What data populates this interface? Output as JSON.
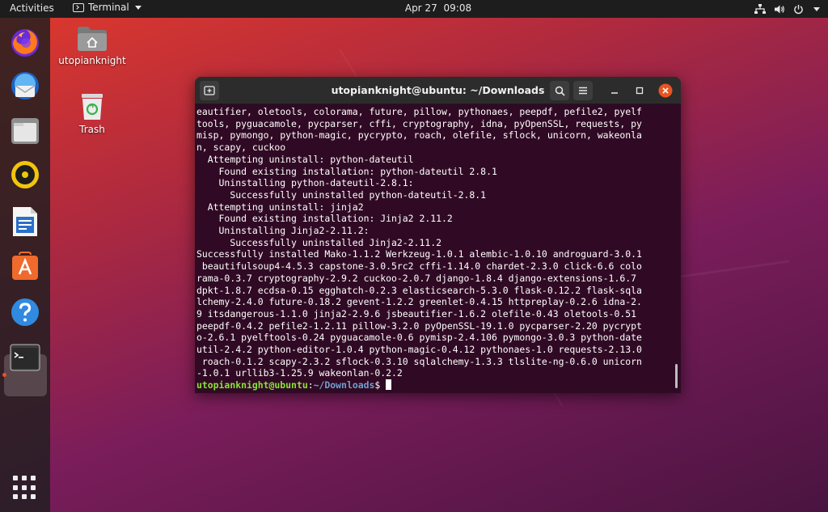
{
  "topbar": {
    "activities": "Activities",
    "app_name": "Terminal",
    "date": "Apr 27",
    "time": "09:08"
  },
  "desktop": {
    "home_label": "utopianknight",
    "trash_label": "Trash"
  },
  "dock": {
    "items": [
      "Firefox Web Browser",
      "Thunderbird Mail",
      "Files",
      "Rhythmbox",
      "LibreOffice Writer",
      "Ubuntu Software",
      "Help",
      "Terminal"
    ]
  },
  "terminal": {
    "title": "utopianknight@ubuntu: ~/Downloads",
    "lines": [
      "eautifier, oletools, colorama, future, pillow, pythonaes, peepdf, pefile2, pyelf",
      "tools, pyguacamole, pycparser, cffi, cryptography, idna, pyOpenSSL, requests, py",
      "misp, pymongo, python-magic, pycrypto, roach, olefile, sflock, unicorn, wakeonla",
      "n, scapy, cuckoo",
      "  Attempting uninstall: python-dateutil",
      "    Found existing installation: python-dateutil 2.8.1",
      "    Uninstalling python-dateutil-2.8.1:",
      "      Successfully uninstalled python-dateutil-2.8.1",
      "  Attempting uninstall: jinja2",
      "    Found existing installation: Jinja2 2.11.2",
      "    Uninstalling Jinja2-2.11.2:",
      "      Successfully uninstalled Jinja2-2.11.2",
      "Successfully installed Mako-1.1.2 Werkzeug-1.0.1 alembic-1.0.10 androguard-3.0.1",
      " beautifulsoup4-4.5.3 capstone-3.0.5rc2 cffi-1.14.0 chardet-2.3.0 click-6.6 colo",
      "rama-0.3.7 cryptography-2.9.2 cuckoo-2.0.7 django-1.8.4 django-extensions-1.6.7",
      "dpkt-1.8.7 ecdsa-0.15 egghatch-0.2.3 elasticsearch-5.3.0 flask-0.12.2 flask-sqla",
      "lchemy-2.4.0 future-0.18.2 gevent-1.2.2 greenlet-0.4.15 httpreplay-0.2.6 idna-2.",
      "9 itsdangerous-1.1.0 jinja2-2.9.6 jsbeautifier-1.6.2 olefile-0.43 oletools-0.51",
      "peepdf-0.4.2 pefile2-1.2.11 pillow-3.2.0 pyOpenSSL-19.1.0 pycparser-2.20 pycrypt",
      "o-2.6.1 pyelftools-0.24 pyguacamole-0.6 pymisp-2.4.106 pymongo-3.0.3 python-date",
      "util-2.4.2 python-editor-1.0.4 python-magic-0.4.12 pythonaes-1.0 requests-2.13.0",
      " roach-0.1.2 scapy-2.3.2 sflock-0.3.10 sqlalchemy-1.3.3 tlslite-ng-0.6.0 unicorn",
      "-1.0.1 urllib3-1.25.9 wakeonlan-0.2.2"
    ],
    "prompt_user": "utopianknight@ubuntu",
    "prompt_sep": ":",
    "prompt_path": "~/Downloads",
    "prompt_symbol": "$"
  },
  "colors": {
    "terminal_bg": "#300a24",
    "prompt_user": "#8ae234",
    "prompt_path": "#729fcf",
    "accent": "#e95420"
  },
  "icons": [
    "terminal-icon",
    "network-icon",
    "volume-icon",
    "power-icon",
    "home-folder-icon",
    "trash-icon",
    "new-tab-icon",
    "search-icon",
    "menu-icon",
    "minimize-icon",
    "maximize-icon",
    "close-icon",
    "show-apps-icon"
  ]
}
